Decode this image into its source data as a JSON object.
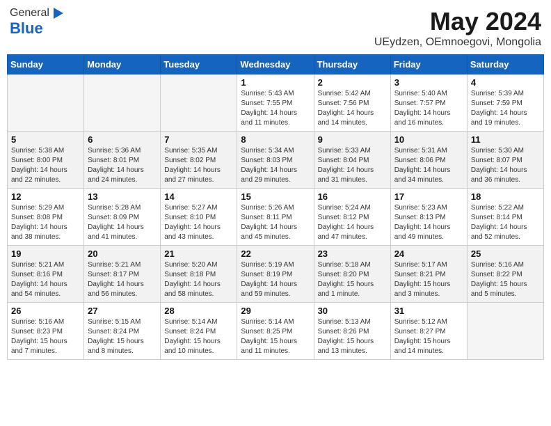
{
  "header": {
    "logo_general": "General",
    "logo_blue": "Blue",
    "month_title": "May 2024",
    "subtitle": "UEydzen, OEmnoegovi, Mongolia"
  },
  "days_of_week": [
    "Sunday",
    "Monday",
    "Tuesday",
    "Wednesday",
    "Thursday",
    "Friday",
    "Saturday"
  ],
  "weeks": [
    [
      {
        "day": "",
        "info": ""
      },
      {
        "day": "",
        "info": ""
      },
      {
        "day": "",
        "info": ""
      },
      {
        "day": "1",
        "info": "Sunrise: 5:43 AM\nSunset: 7:55 PM\nDaylight: 14 hours\nand 11 minutes."
      },
      {
        "day": "2",
        "info": "Sunrise: 5:42 AM\nSunset: 7:56 PM\nDaylight: 14 hours\nand 14 minutes."
      },
      {
        "day": "3",
        "info": "Sunrise: 5:40 AM\nSunset: 7:57 PM\nDaylight: 14 hours\nand 16 minutes."
      },
      {
        "day": "4",
        "info": "Sunrise: 5:39 AM\nSunset: 7:59 PM\nDaylight: 14 hours\nand 19 minutes."
      }
    ],
    [
      {
        "day": "5",
        "info": "Sunrise: 5:38 AM\nSunset: 8:00 PM\nDaylight: 14 hours\nand 22 minutes."
      },
      {
        "day": "6",
        "info": "Sunrise: 5:36 AM\nSunset: 8:01 PM\nDaylight: 14 hours\nand 24 minutes."
      },
      {
        "day": "7",
        "info": "Sunrise: 5:35 AM\nSunset: 8:02 PM\nDaylight: 14 hours\nand 27 minutes."
      },
      {
        "day": "8",
        "info": "Sunrise: 5:34 AM\nSunset: 8:03 PM\nDaylight: 14 hours\nand 29 minutes."
      },
      {
        "day": "9",
        "info": "Sunrise: 5:33 AM\nSunset: 8:04 PM\nDaylight: 14 hours\nand 31 minutes."
      },
      {
        "day": "10",
        "info": "Sunrise: 5:31 AM\nSunset: 8:06 PM\nDaylight: 14 hours\nand 34 minutes."
      },
      {
        "day": "11",
        "info": "Sunrise: 5:30 AM\nSunset: 8:07 PM\nDaylight: 14 hours\nand 36 minutes."
      }
    ],
    [
      {
        "day": "12",
        "info": "Sunrise: 5:29 AM\nSunset: 8:08 PM\nDaylight: 14 hours\nand 38 minutes."
      },
      {
        "day": "13",
        "info": "Sunrise: 5:28 AM\nSunset: 8:09 PM\nDaylight: 14 hours\nand 41 minutes."
      },
      {
        "day": "14",
        "info": "Sunrise: 5:27 AM\nSunset: 8:10 PM\nDaylight: 14 hours\nand 43 minutes."
      },
      {
        "day": "15",
        "info": "Sunrise: 5:26 AM\nSunset: 8:11 PM\nDaylight: 14 hours\nand 45 minutes."
      },
      {
        "day": "16",
        "info": "Sunrise: 5:24 AM\nSunset: 8:12 PM\nDaylight: 14 hours\nand 47 minutes."
      },
      {
        "day": "17",
        "info": "Sunrise: 5:23 AM\nSunset: 8:13 PM\nDaylight: 14 hours\nand 49 minutes."
      },
      {
        "day": "18",
        "info": "Sunrise: 5:22 AM\nSunset: 8:14 PM\nDaylight: 14 hours\nand 52 minutes."
      }
    ],
    [
      {
        "day": "19",
        "info": "Sunrise: 5:21 AM\nSunset: 8:16 PM\nDaylight: 14 hours\nand 54 minutes."
      },
      {
        "day": "20",
        "info": "Sunrise: 5:21 AM\nSunset: 8:17 PM\nDaylight: 14 hours\nand 56 minutes."
      },
      {
        "day": "21",
        "info": "Sunrise: 5:20 AM\nSunset: 8:18 PM\nDaylight: 14 hours\nand 58 minutes."
      },
      {
        "day": "22",
        "info": "Sunrise: 5:19 AM\nSunset: 8:19 PM\nDaylight: 14 hours\nand 59 minutes."
      },
      {
        "day": "23",
        "info": "Sunrise: 5:18 AM\nSunset: 8:20 PM\nDaylight: 15 hours\nand 1 minute."
      },
      {
        "day": "24",
        "info": "Sunrise: 5:17 AM\nSunset: 8:21 PM\nDaylight: 15 hours\nand 3 minutes."
      },
      {
        "day": "25",
        "info": "Sunrise: 5:16 AM\nSunset: 8:22 PM\nDaylight: 15 hours\nand 5 minutes."
      }
    ],
    [
      {
        "day": "26",
        "info": "Sunrise: 5:16 AM\nSunset: 8:23 PM\nDaylight: 15 hours\nand 7 minutes."
      },
      {
        "day": "27",
        "info": "Sunrise: 5:15 AM\nSunset: 8:24 PM\nDaylight: 15 hours\nand 8 minutes."
      },
      {
        "day": "28",
        "info": "Sunrise: 5:14 AM\nSunset: 8:24 PM\nDaylight: 15 hours\nand 10 minutes."
      },
      {
        "day": "29",
        "info": "Sunrise: 5:14 AM\nSunset: 8:25 PM\nDaylight: 15 hours\nand 11 minutes."
      },
      {
        "day": "30",
        "info": "Sunrise: 5:13 AM\nSunset: 8:26 PM\nDaylight: 15 hours\nand 13 minutes."
      },
      {
        "day": "31",
        "info": "Sunrise: 5:12 AM\nSunset: 8:27 PM\nDaylight: 15 hours\nand 14 minutes."
      },
      {
        "day": "",
        "info": ""
      }
    ]
  ]
}
